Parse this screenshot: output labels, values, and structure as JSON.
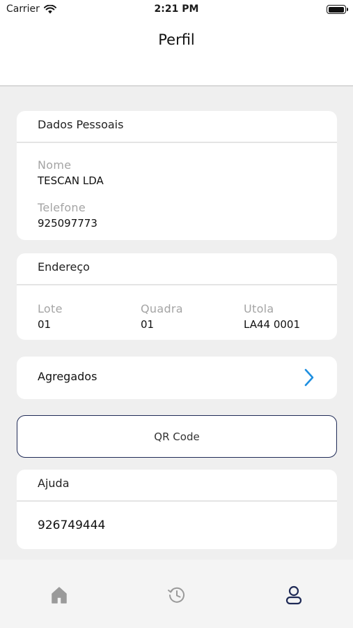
{
  "status_bar": {
    "carrier": "Carrier",
    "time": "2:21 PM"
  },
  "header": {
    "title": "Perfil"
  },
  "personal": {
    "title": "Dados Pessoais",
    "name_label": "Nome",
    "name_value": "TESCAN LDA",
    "phone_label": "Telefone",
    "phone_value": "925097773"
  },
  "address": {
    "title": "Endereço",
    "columns": [
      {
        "label": "Lote",
        "value": "01"
      },
      {
        "label": "Quadra",
        "value": "01"
      },
      {
        "label": "Utola",
        "value": "LA44 0001"
      }
    ]
  },
  "agregados": {
    "label": "Agregados"
  },
  "qr_code": {
    "label": "QR Code"
  },
  "help": {
    "title": "Ajuda",
    "phone": "926749444"
  },
  "tabs": {
    "items": [
      "home-icon",
      "history-icon",
      "profile-icon"
    ],
    "active": "profile-icon"
  },
  "colors": {
    "accent": "#1e8fe0",
    "nav_dark": "#1f2a56",
    "icon_inactive": "#9a9a9a"
  }
}
